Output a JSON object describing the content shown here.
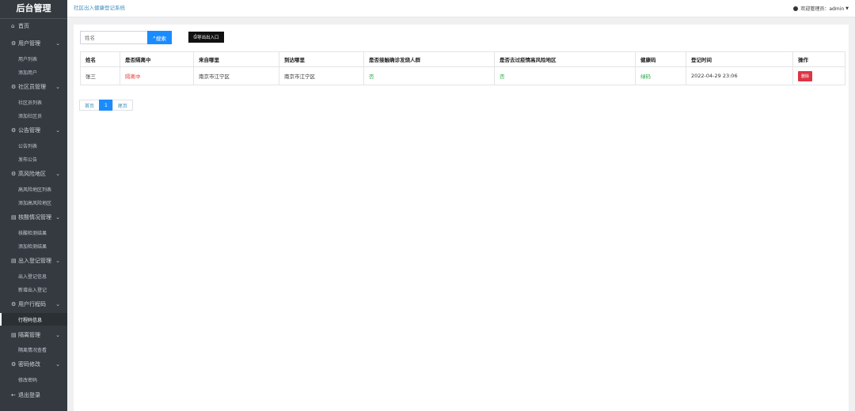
{
  "app": {
    "brand": "后台管理"
  },
  "header": {
    "breadcrumb": "社区出入健康登记系统",
    "user_label": "欢迎管理员：admin"
  },
  "sidebar": {
    "home": "首页",
    "groups": [
      {
        "label": "用户管理",
        "children": [
          "用户列表",
          "添加用户"
        ]
      },
      {
        "label": "社区员管理",
        "children": [
          "社区员列表",
          "添加社区员"
        ]
      },
      {
        "label": "公告管理",
        "children": [
          "公告列表",
          "发布公告"
        ]
      },
      {
        "label": "高风险地区",
        "children": [
          "高风险地区列表",
          "添加高风险地区"
        ]
      },
      {
        "label": "核酸情况管理",
        "children": [
          "核酸检测结果",
          "添加检测结果"
        ]
      },
      {
        "label": "出入登记管理",
        "children": [
          "出入登记信息",
          "新增出入登记"
        ]
      },
      {
        "label": "用户行程码",
        "children": [
          "行程码信息"
        ]
      },
      {
        "label": "隔离管理",
        "children": [
          "隔离情况查看"
        ]
      },
      {
        "label": "密码修改",
        "children": [
          "修改密码"
        ]
      }
    ],
    "logout": "退出登录",
    "active": "行程码信息"
  },
  "toolbar": {
    "search_placeholder": "姓名",
    "search_label": "搜索",
    "export_label": "导出出入口"
  },
  "table": {
    "columns": [
      "姓名",
      "是否隔离中",
      "来自哪里",
      "到达哪里",
      "是否接触确诊发烧人群",
      "是否去过疫情高风险地区",
      "健康码",
      "登记时间",
      "操作"
    ],
    "rows": [
      {
        "name": "张三",
        "isolating": "隔离中",
        "from": "南京市江宁区",
        "to": "南京市江宁区",
        "contact": "否",
        "risk_area": "否",
        "health_code": "绿码",
        "time": "2022-04-29 23:06",
        "action": "删除"
      }
    ]
  },
  "pagination": {
    "first": "首页",
    "current": "1",
    "last": "尾页"
  },
  "colors": {
    "sidebar": "#343a40",
    "primary": "#1a8cff",
    "danger": "#dc3545",
    "success": "#28a745"
  }
}
